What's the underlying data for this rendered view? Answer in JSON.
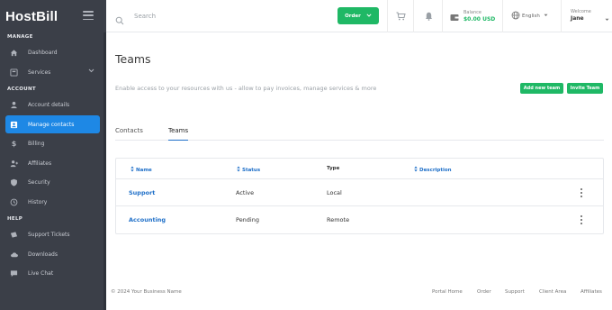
{
  "brand": {
    "host": "Host",
    "bill": "Bill"
  },
  "sidebar": {
    "sections": [
      {
        "title": "MANAGE"
      },
      {
        "title": "ACCOUNT"
      },
      {
        "title": "HELP"
      }
    ],
    "items": [
      {
        "label": "Dashboard",
        "icon": "home-icon"
      },
      {
        "label": "Services",
        "icon": "services-icon"
      },
      {
        "label": "Account details",
        "icon": "user-icon"
      },
      {
        "label": "Manage contacts",
        "icon": "contacts-icon",
        "active": true
      },
      {
        "label": "Billing",
        "icon": "dollar-icon"
      },
      {
        "label": "Affiliates",
        "icon": "affiliates-icon"
      },
      {
        "label": "Security",
        "icon": "shield-icon"
      },
      {
        "label": "History",
        "icon": "history-icon"
      },
      {
        "label": "Support Tickets",
        "icon": "ticket-icon"
      },
      {
        "label": "Downloads",
        "icon": "download-icon"
      },
      {
        "label": "Live Chat",
        "icon": "chat-icon"
      }
    ]
  },
  "topbar": {
    "search_placeholder": "Search",
    "order_label": "Order",
    "balance_label": "Balance",
    "balance_value": "$0.00 USD",
    "language": "English",
    "welcome_label": "Welcome",
    "user_name": "Jane"
  },
  "page": {
    "title": "Teams",
    "description": "Enable access to your resources with us - allow to pay invoices, manage services & more",
    "add_team_label": "Add new team",
    "invite_team_label": "Invite Team",
    "tabs": [
      {
        "label": "Contacts",
        "active": false
      },
      {
        "label": "Teams",
        "active": true
      }
    ]
  },
  "table": {
    "headers": {
      "name": "Name",
      "status": "Status",
      "type": "Type",
      "description": "Description"
    },
    "rows": [
      {
        "name": "Support",
        "status": "Active",
        "type": "Local",
        "description": ""
      },
      {
        "name": "Accounting",
        "status": "Pending",
        "type": "Remote",
        "description": ""
      }
    ]
  },
  "footer": {
    "copyright": "© 2024 Your Business Name",
    "links": [
      "Portal Home",
      "Order",
      "Support",
      "Client Area",
      "Affiliates"
    ]
  },
  "colors": {
    "sidebar": "#3b3f48",
    "accent_blue": "#1e88e5",
    "green": "#1fb865",
    "link": "#1e6fc8"
  }
}
